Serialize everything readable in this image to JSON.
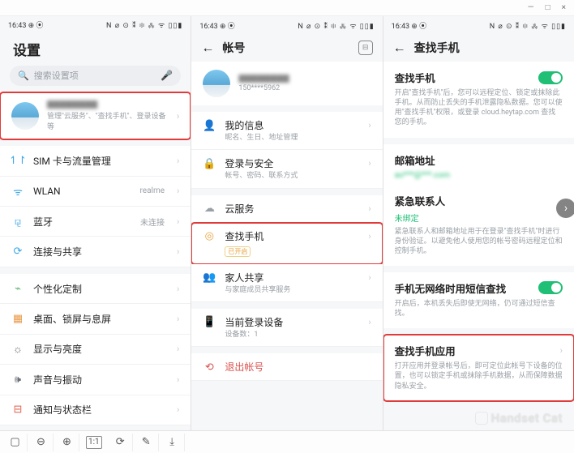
{
  "window": {
    "min": "—",
    "max": "□",
    "close": "×"
  },
  "statusbar": {
    "time": "16:43 ⊕ ⦿",
    "right": "N ⌀ ⊙ ⁑ ፨ ⁂ ᯤ ▯▯▮"
  },
  "pane1": {
    "title": "设置",
    "search_placeholder": "搜索设置项",
    "account": {
      "name_blur": "████████",
      "sub": "管理\"云服务\"、\"查找手机\"、登录设备等"
    },
    "groups": [
      [
        {
          "icon": "↿↾",
          "icon_color": "#3aa6e8",
          "label": "SIM 卡与流量管理"
        },
        {
          "icon": "ᯤ",
          "icon_color": "#3aa6e8",
          "label": "WLAN",
          "value": "realme"
        },
        {
          "icon": "⚼",
          "icon_color": "#3aa6e8",
          "label": "蓝牙",
          "value": "未连接"
        },
        {
          "icon": "⟳",
          "icon_color": "#3aa6e8",
          "label": "连接与共享"
        }
      ],
      [
        {
          "icon": "⌁",
          "icon_color": "#5ab56a",
          "label": "个性化定制"
        },
        {
          "icon": "▦",
          "icon_color": "#e89a4a",
          "label": "桌面、锁屏与息屏"
        },
        {
          "icon": "☼",
          "icon_color": "#6a6f78",
          "label": "显示与亮度"
        },
        {
          "icon": "🕪",
          "icon_color": "#6a6f78",
          "label": "声音与振动"
        },
        {
          "icon": "⊟",
          "icon_color": "#e0604f",
          "label": "通知与状态栏"
        }
      ]
    ]
  },
  "pane2": {
    "title": "帐号",
    "profile": {
      "name_blur": "████████",
      "phone": "150****5962"
    },
    "items": [
      {
        "icon": "👤",
        "label": "我的信息",
        "sub": "昵名、生日、地址管理"
      },
      {
        "icon": "🔒",
        "icon_color": "#6b86f0",
        "label": "登录与安全",
        "sub": "帐号、密码、联系方式"
      }
    ],
    "cloud": [
      {
        "icon": "☁",
        "icon_color": "#9aa0a6",
        "label": "云服务"
      },
      {
        "icon": "◎",
        "icon_color": "#e6a23c",
        "label": "查找手机",
        "badge": "已开启",
        "highlight": true
      },
      {
        "icon": "👥",
        "icon_color": "#9aa0a6",
        "label": "家人共享",
        "sub": "与家庭成员共享服务"
      }
    ],
    "device": [
      {
        "icon": "📱",
        "icon_color": "#9aa0a6",
        "label": "当前登录设备",
        "sub": "设备数：1"
      }
    ],
    "logout": {
      "icon": "⟲",
      "label": "退出帐号"
    }
  },
  "pane3": {
    "title": "查找手机",
    "main": {
      "label": "查找手机",
      "desc": "开启\"查找手机\"后，您可以远程定位、锁定或抹除此手机。从而防止丢失的手机泄露隐私数据。您可以使用\"查找手机\"权限，或登录 cloud.heytap.com 查找您的手机。"
    },
    "email": {
      "label": "邮箱地址",
      "value": "ao***@***.com"
    },
    "contact": {
      "label": "紧急联系人",
      "status": "未绑定",
      "desc": "紧急联系人和邮箱地址用于在登录\"查找手机\"时进行身份验证。以避免他人使用您的帐号密码远程定位和控制手机。"
    },
    "sms": {
      "label": "手机无网络时用短信查找",
      "desc": "开启后，本机丢失后即使无网络，仍可通过短信查找。"
    },
    "app": {
      "label": "查找手机应用",
      "desc": "打开应用并登录帐号后，即可定位此帐号下设备的位置，也可以锁定手机或抹除手机数据，从而保障数据隐私安全。"
    }
  },
  "watermark": "Handset Cat",
  "toolbar": {
    "fit": "▢",
    "zoom_out": "⊖",
    "zoom_in": "⊕",
    "one": "1:1",
    "rotate": "⟳",
    "edit": "✎",
    "download": "⤓"
  }
}
